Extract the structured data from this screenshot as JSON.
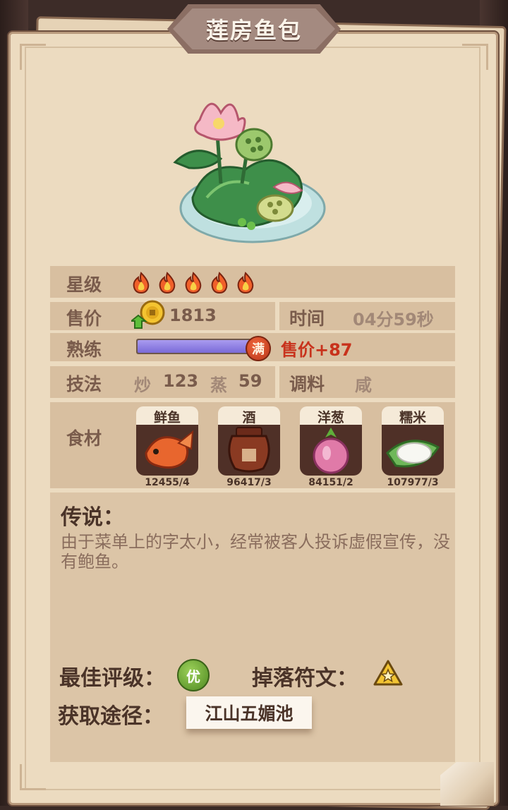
{
  "title": "莲房鱼包",
  "dish_image": "lotus-fish-bun-dish",
  "stats": {
    "star_label": "星级",
    "star_count": 5,
    "price_label": "售价",
    "price_value": "1813",
    "time_label": "时间",
    "time_value": "04分59秒",
    "proficiency_label": "熟练",
    "proficiency_fraction": 1.0,
    "full_badge": "满",
    "price_bonus": "售价+87",
    "technique_label": "技法",
    "technique_1_name": "炒",
    "technique_1_value": "123",
    "technique_2_name": "蒸",
    "technique_2_value": "59",
    "seasoning_label": "调料",
    "seasoning_value": "咸"
  },
  "ingredients": {
    "label": "食材",
    "items": [
      {
        "name": "鲜鱼",
        "count": "12455/4",
        "icon": "fish-icon"
      },
      {
        "name": "酒",
        "count": "96417/3",
        "icon": "wine-jar-icon"
      },
      {
        "name": "洋葱",
        "count": "84151/2",
        "icon": "onion-icon"
      },
      {
        "name": "糯米",
        "count": "107977/3",
        "icon": "rice-icon"
      }
    ]
  },
  "legend": {
    "title": "传说：",
    "text": "由于菜单上的字太小，经常被客人投诉虚假宣传，没有鲍鱼。"
  },
  "best_rating_label": "最佳评级：",
  "best_rating_badge": "优",
  "drop_rune_label": "掉落符文：",
  "source_label": "获取途径：",
  "source_value": "江山五媚池",
  "colors": {
    "card_bg": "#ecdbc0",
    "row_bg": "#d8bfa0",
    "text_brown": "#7a5c4c",
    "bonus_red": "#c8321c",
    "bar_purple": "#8f80e6",
    "grade_green": "#5f9a2c"
  }
}
